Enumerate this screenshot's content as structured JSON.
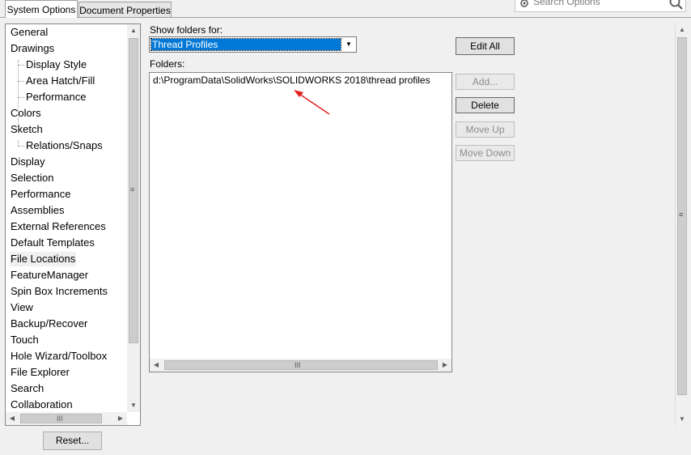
{
  "tabs": [
    {
      "label": "System Options",
      "active": true
    },
    {
      "label": "Document Properties",
      "active": false
    }
  ],
  "search": {
    "placeholder": "Search Options",
    "icon": "gear-icon"
  },
  "nav": {
    "items": [
      {
        "label": "General",
        "level": 0
      },
      {
        "label": "Drawings",
        "level": 0
      },
      {
        "label": "Display Style",
        "level": 1
      },
      {
        "label": "Area Hatch/Fill",
        "level": 1
      },
      {
        "label": "Performance",
        "level": 1
      },
      {
        "label": "Colors",
        "level": 0
      },
      {
        "label": "Sketch",
        "level": 0
      },
      {
        "label": "Relations/Snaps",
        "level": 1
      },
      {
        "label": "Display",
        "level": 0
      },
      {
        "label": "Selection",
        "level": 0
      },
      {
        "label": "Performance",
        "level": 0
      },
      {
        "label": "Assemblies",
        "level": 0
      },
      {
        "label": "External References",
        "level": 0
      },
      {
        "label": "Default Templates",
        "level": 0
      },
      {
        "label": "File Locations",
        "level": 0,
        "selected": true
      },
      {
        "label": "FeatureManager",
        "level": 0
      },
      {
        "label": "Spin Box Increments",
        "level": 0
      },
      {
        "label": "View",
        "level": 0
      },
      {
        "label": "Backup/Recover",
        "level": 0
      },
      {
        "label": "Touch",
        "level": 0
      },
      {
        "label": "Hole Wizard/Toolbox",
        "level": 0
      },
      {
        "label": "File Explorer",
        "level": 0
      },
      {
        "label": "Search",
        "level": 0
      },
      {
        "label": "Collaboration",
        "level": 0
      }
    ]
  },
  "reset_label": "Reset...",
  "show_folders": {
    "label": "Show folders for:",
    "selected": "Thread Profiles"
  },
  "folders": {
    "label": "Folders:",
    "rows": [
      "d:\\ProgramData\\SolidWorks\\SOLIDWORKS 2018\\thread profiles"
    ]
  },
  "buttons": {
    "edit_all": "Edit All",
    "add": "Add...",
    "delete": "Delete",
    "move_up": "Move Up",
    "move_down": "Move Down"
  },
  "colors": {
    "selection": "#0078d7",
    "annotation_arrow": "#e02020"
  }
}
